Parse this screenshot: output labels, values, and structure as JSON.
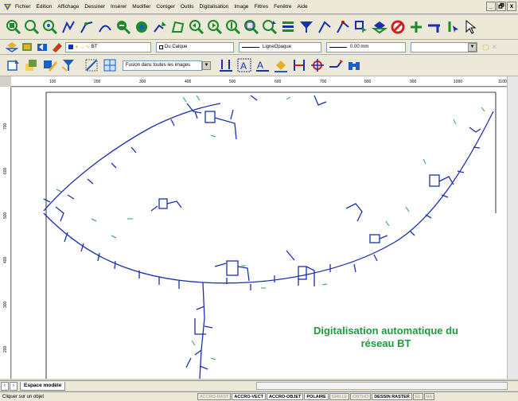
{
  "menu": {
    "items": [
      "Fichier",
      "Edition",
      "Affichage",
      "Dessiner",
      "Insérer",
      "Modifier",
      "Corriger",
      "Outils",
      "Digitalisation",
      "Image",
      "Filtres",
      "Fenêtre",
      "Aide"
    ]
  },
  "window_controls": [
    "_",
    "🗗",
    "x"
  ],
  "properties_bar": {
    "layer": "BT",
    "color": "Du Calque",
    "linetype": "LigneOpaque",
    "lineweight": "0.00 mm"
  },
  "raster_bar": {
    "merge_mode": "Fusion dans toutes les images"
  },
  "ruler": {
    "top_ticks": [
      "100",
      "200",
      "300",
      "400",
      "500",
      "600",
      "700",
      "800",
      "900",
      "1000",
      "1100"
    ],
    "left_ticks": [
      "700",
      "600",
      "500",
      "400",
      "300",
      "200"
    ]
  },
  "canvas": {
    "caption_line1": "Digitalisation automatique du",
    "caption_line2": "réseau BT"
  },
  "tabs": {
    "model_tab": "Espace modèle"
  },
  "status": {
    "prompt": "Cliquer sur un objet",
    "buttons": [
      {
        "label": "ACCRO-RAST",
        "on": false
      },
      {
        "label": "ACCRO-VECT",
        "on": true
      },
      {
        "label": "ACCRO-OBJET",
        "on": true
      },
      {
        "label": "POLAIRE",
        "on": true
      },
      {
        "label": "GRILLE",
        "on": false
      },
      {
        "label": "ORTHO",
        "on": false
      },
      {
        "label": "DESSIN RASTER",
        "on": true
      },
      {
        "label": "EL",
        "on": false
      },
      {
        "label": "HA",
        "on": false
      }
    ]
  },
  "colors": {
    "network_line": "#1a2fb0",
    "annotation": "#27a84a",
    "caption": "#1e9a3c"
  }
}
